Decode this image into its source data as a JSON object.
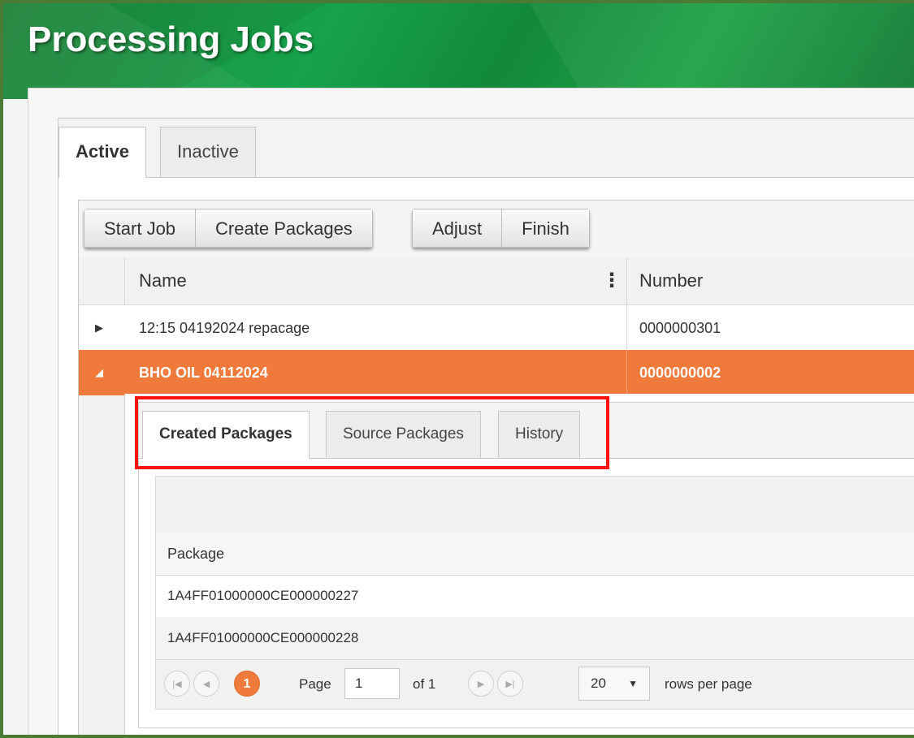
{
  "page": {
    "title": "Processing Jobs"
  },
  "main_tabs": [
    "Active",
    "Inactive"
  ],
  "toolbar": {
    "start_job": "Start Job",
    "create_packages": "Create Packages",
    "adjust": "Adjust",
    "finish": "Finish"
  },
  "grid": {
    "columns": [
      "Name",
      "Number"
    ],
    "rows": [
      {
        "name": "12:15 04192024 repacage",
        "number": "0000000301",
        "expanded": false
      },
      {
        "name": "BHO OIL 04112024",
        "number": "0000000002",
        "expanded": true
      }
    ]
  },
  "detail": {
    "tabs": [
      "Created Packages",
      "Source Packages",
      "History"
    ],
    "column": "Package",
    "packages": [
      "1A4FF01000000CE000000227",
      "1A4FF01000000CE000000228"
    ],
    "pager": {
      "current_page": "1",
      "page_label": "Page",
      "page_value": "1",
      "of_label": "of 1",
      "rows_per_page": "20",
      "rows_per_page_label": "rows per page"
    }
  },
  "colors": {
    "header_green": "#16a34a",
    "selected_row": "#f07a3c",
    "highlight": "#ff1111"
  },
  "icons": {
    "collapsed": "triangle-right-icon",
    "expanded": "triangle-down-icon",
    "column_menu": "vertical-dots-icon",
    "first": "first-page-icon",
    "prev": "previous-page-icon",
    "next": "next-page-icon",
    "last": "last-page-icon",
    "dropdown": "caret-down-icon"
  }
}
